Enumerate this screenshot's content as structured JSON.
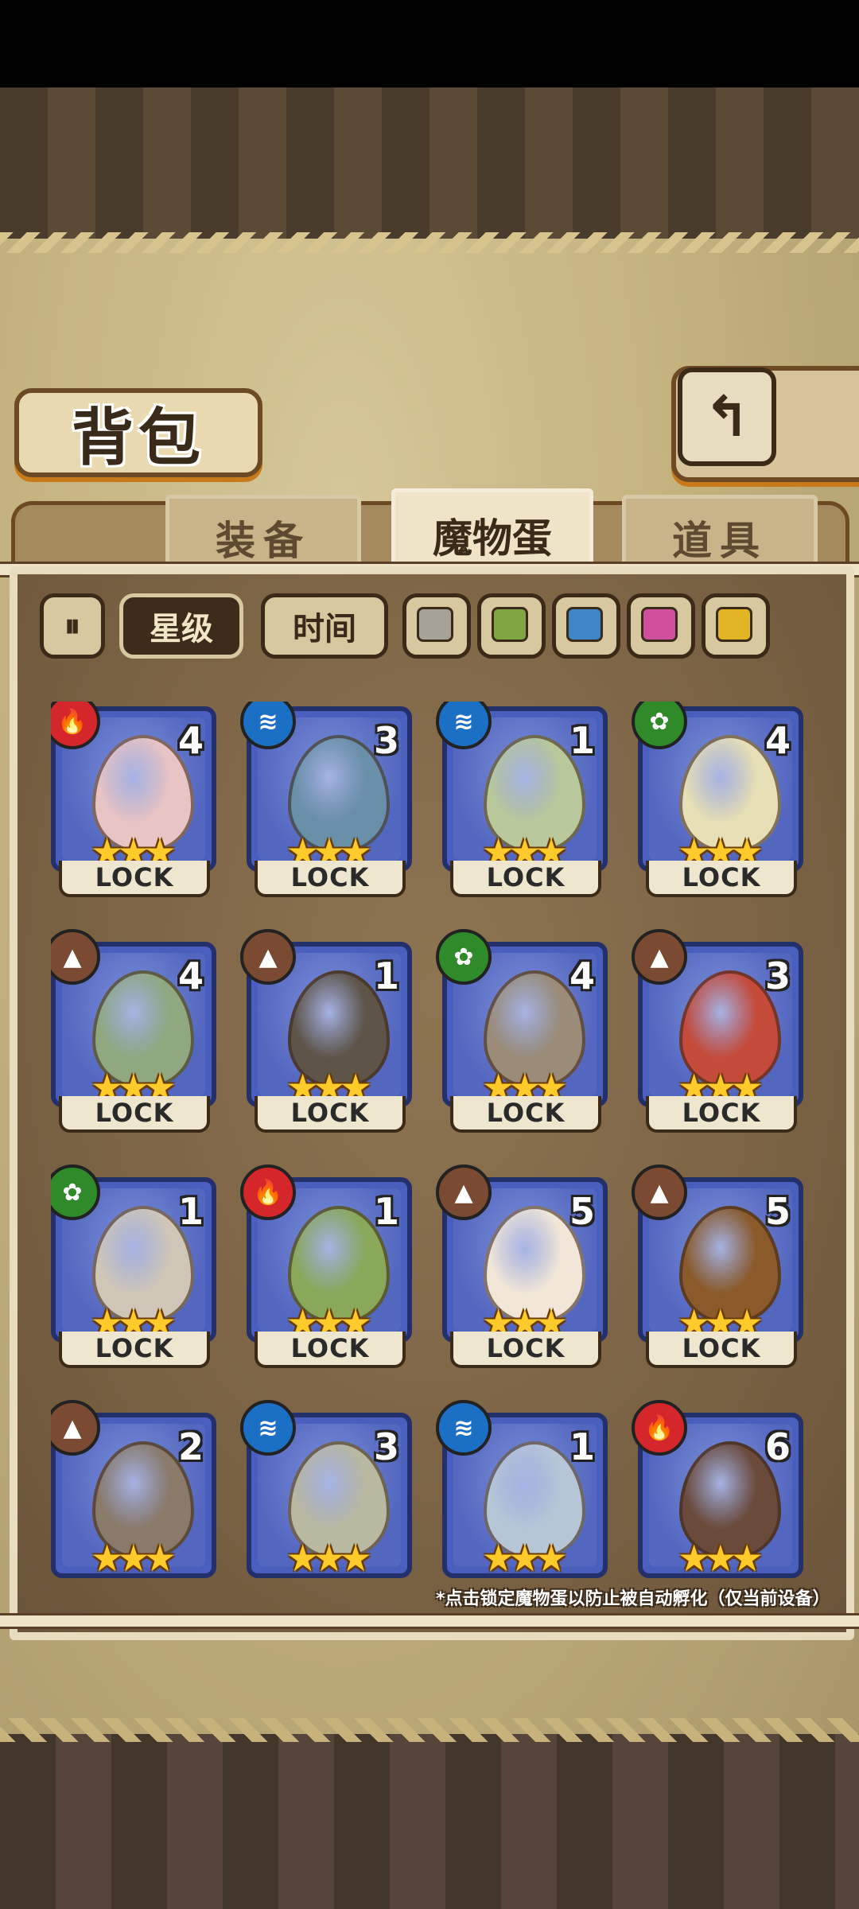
{
  "header": {
    "title": "背包",
    "back_icon": "↰"
  },
  "tabs": [
    {
      "label": "装备",
      "active": false
    },
    {
      "label": "魔物蛋",
      "active": true
    },
    {
      "label": "道具",
      "active": false
    }
  ],
  "filters": {
    "toggle_icon": "⏸",
    "sort_star": "星级",
    "sort_time": "时间",
    "colors": [
      "#a7a297",
      "#7fa640",
      "#3f86c8",
      "#d0509e",
      "#e2b424"
    ]
  },
  "elements": {
    "fire": {
      "icon": "🔥",
      "color": "#d4262b"
    },
    "water": {
      "icon": "≋",
      "color": "#1b6fc4"
    },
    "plant": {
      "icon": "✿",
      "color": "#2f8a2a"
    },
    "earth": {
      "icon": "▲",
      "color": "#7a4a33"
    }
  },
  "eggs": [
    {
      "element": "fire",
      "count": "4",
      "stars": "★★★",
      "lock": "LOCK",
      "color": "#e8c4c4"
    },
    {
      "element": "water",
      "count": "3",
      "stars": "★★★",
      "lock": "LOCK",
      "color": "#6a8fa8"
    },
    {
      "element": "water",
      "count": "1",
      "stars": "★★★",
      "lock": "LOCK",
      "color": "#b8c89a"
    },
    {
      "element": "plant",
      "count": "4",
      "stars": "★★★",
      "lock": "LOCK",
      "color": "#e7dfb5"
    },
    {
      "element": "earth",
      "count": "4",
      "stars": "★★★",
      "lock": "LOCK",
      "color": "#8fa880"
    },
    {
      "element": "earth",
      "count": "1",
      "stars": "★★★",
      "lock": "LOCK",
      "color": "#5e5448"
    },
    {
      "element": "plant",
      "count": "4",
      "stars": "★★★",
      "lock": "LOCK",
      "color": "#9a8c78"
    },
    {
      "element": "earth",
      "count": "3",
      "stars": "★★★",
      "lock": "LOCK",
      "color": "#c44a3a"
    },
    {
      "element": "plant",
      "count": "1",
      "stars": "★★★",
      "lock": "LOCK",
      "color": "#cfc6b8"
    },
    {
      "element": "fire",
      "count": "1",
      "stars": "★★★",
      "lock": "LOCK",
      "color": "#8aa85a"
    },
    {
      "element": "earth",
      "count": "5",
      "stars": "★★★",
      "lock": "LOCK",
      "color": "#f1e6d8"
    },
    {
      "element": "earth",
      "count": "5",
      "stars": "★★★",
      "lock": "LOCK",
      "color": "#8a5a2a"
    },
    {
      "element": "earth",
      "count": "2",
      "stars": "★★★",
      "lock": "",
      "color": "#8a7a6a"
    },
    {
      "element": "water",
      "count": "3",
      "stars": "★★★",
      "lock": "",
      "color": "#b9b8a0"
    },
    {
      "element": "water",
      "count": "1",
      "stars": "★★★",
      "lock": "",
      "color": "#b6c6d6"
    },
    {
      "element": "fire",
      "count": "6",
      "stars": "★★★",
      "lock": "",
      "color": "#6a4a3a"
    }
  ],
  "hint": "*点击锁定魔物蛋以防止被自动孵化（仅当前设备）"
}
